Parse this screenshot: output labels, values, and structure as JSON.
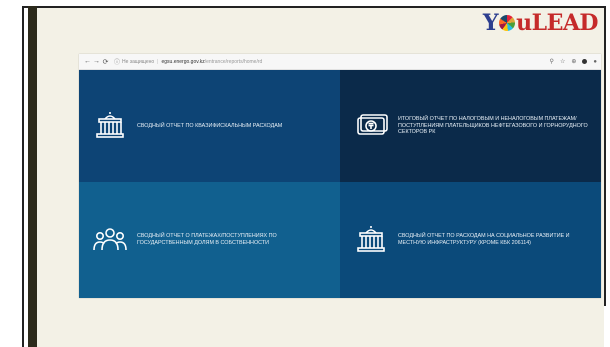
{
  "logo": {
    "part1": "Y",
    "part2": "uLEAD"
  },
  "browser": {
    "back_icon": "arrow-left-icon",
    "forward_icon": "arrow-right-icon",
    "reload_icon": "reload-icon",
    "addr_warning": "Не защищено",
    "addr_host": "egsu.energo.gov.kz",
    "addr_path": "/entrance/reports/home/rd",
    "toolbar_icons": [
      "zoom-icon",
      "star-icon",
      "extension-icon",
      "profile-icon"
    ]
  },
  "tiles": [
    {
      "label": "Сводный отчет по квазифискальным расходам",
      "icon": "government-building-icon"
    },
    {
      "label": "Итоговый отчет по налоговым и неналоговым платежам/поступлениям плательщиков нефтегазового и горнорудного секторов РК",
      "icon": "tenge-banknote-icon"
    },
    {
      "label": "Сводный отчет о платежах/поступлениях по государственным долям в собственности",
      "icon": "people-group-icon"
    },
    {
      "label": "Сводный отчет по расходам на социальное развитие и местную инфраструктуру (кроме КБК 206114)",
      "icon": "government-building-icon"
    }
  ],
  "colors": {
    "tile_1": "#0d4475",
    "tile_2": "#0b2a4a",
    "tile_3": "#11608f",
    "tile_4": "#0b4a7a",
    "logo_blue": "#2c3e8f",
    "logo_red": "#c52a2a"
  }
}
